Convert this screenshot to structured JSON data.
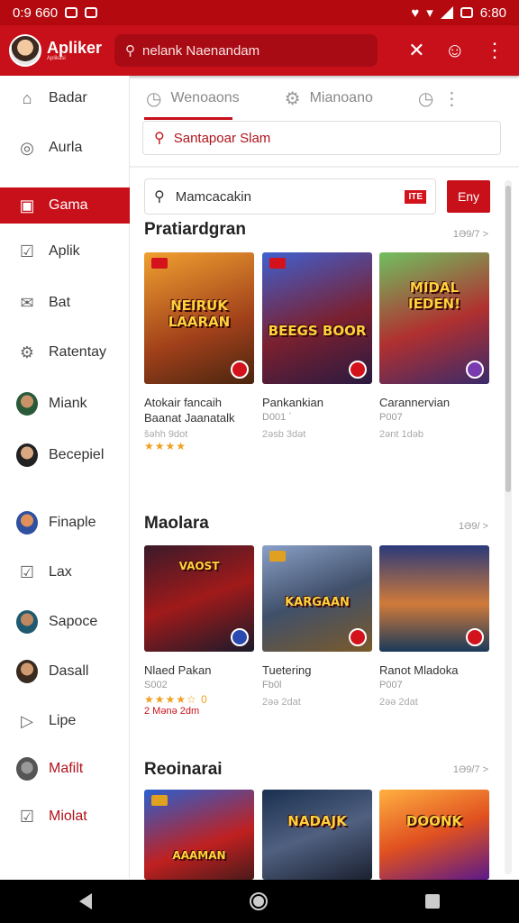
{
  "status_bar": {
    "time": "0:9 660",
    "right_text": "6:80"
  },
  "app_bar": {
    "title": "Apliker",
    "subtitle": "Aplikasi",
    "search_text": "nelank Naenandam"
  },
  "sidebar": {
    "items": [
      {
        "label": "Badar",
        "icon": "home-icon"
      },
      {
        "label": "Aurla",
        "icon": "circle-icon"
      },
      {
        "label": "Gama",
        "icon": "gamepad-icon",
        "active": true
      },
      {
        "label": "Aplik",
        "icon": "bag-icon"
      },
      {
        "label": "Bat",
        "icon": "mail-icon"
      },
      {
        "label": "Ratentay",
        "icon": "settings-icon"
      },
      {
        "label": "Miank",
        "icon": "avatar-icon"
      },
      {
        "label": "Becepiel",
        "icon": "avatar-icon"
      },
      {
        "label": "Finaple",
        "icon": "avatar-icon"
      },
      {
        "label": "Lax",
        "icon": "box-icon"
      },
      {
        "label": "Sapoce",
        "icon": "avatar-icon"
      },
      {
        "label": "Dasall",
        "icon": "avatar-icon"
      },
      {
        "label": "Lipe",
        "icon": "play-icon"
      },
      {
        "label": "Mafilt",
        "icon": "avatar-icon"
      },
      {
        "label": "Miolat",
        "icon": "box-icon"
      }
    ]
  },
  "tabs": [
    {
      "label": "Wenoaons",
      "icon": "clock-icon"
    },
    {
      "label": "Mianoano",
      "icon": "settings-icon"
    }
  ],
  "secondary_search": "Santapoar Slam",
  "main_search": {
    "value": "Mamcacakin",
    "badge": "ITE",
    "button": "Eny"
  },
  "sections": [
    {
      "title": "Pratiardgran",
      "more": "1Ə9/7 >",
      "cards": [
        {
          "logo": "NEIRUK LAARAN",
          "name": "Atokair fancaih",
          "sub": "Baanat Jaanatalk",
          "meta": "šəhh 9dot",
          "stars": "★★★★",
          "colors": [
            "#d9791e",
            "#4a2510"
          ]
        },
        {
          "logo": "BEEGS BOOR",
          "name": "Pankankian",
          "sub": "D001 ´",
          "meta": "2əsb 3dət",
          "colors": [
            "#2f4fb8",
            "#9a1f22"
          ]
        },
        {
          "logo": "MIDAL IEDEN!",
          "name": "Carannervian",
          "sub": "P007",
          "meta": "2ənt 1dəb",
          "colors": [
            "#3b8a4c",
            "#b4242a"
          ]
        }
      ]
    },
    {
      "title": "Maolara",
      "more": "1Ə9/ >",
      "cards": [
        {
          "logo": "VAOST",
          "name": "Nlaed Pakan",
          "sub": "S002",
          "meta": "★★★★☆ 0",
          "stars_label": "2 Mənə 2dm",
          "colors": [
            "#8a1414",
            "#2a2030"
          ]
        },
        {
          "logo": "KARGAAN",
          "name": "Tuetering",
          "sub": "Fb0l",
          "meta": "2əə 2dat",
          "colors": [
            "#4a6a9a",
            "#6a5020"
          ]
        },
        {
          "logo": "",
          "name": "Ranot Mladoka",
          "sub": "P007",
          "meta": "2əə 2dat",
          "colors": [
            "#1a3a6a",
            "#b06a2a"
          ]
        }
      ]
    },
    {
      "title": "Reoinarai",
      "more": "1Ə9/7 >",
      "cards": [
        {
          "logo": "AAAMAN",
          "name": "",
          "sub": "",
          "meta": "",
          "colors": [
            "#1a4ab0",
            "#c02020"
          ]
        },
        {
          "logo": "NADAJK",
          "name": "",
          "sub": "",
          "meta": "",
          "colors": [
            "#1a3050",
            "#506080"
          ]
        },
        {
          "logo": "DOONK",
          "name": "",
          "sub": "",
          "meta": "",
          "colors": [
            "#e07020",
            "#5a1a8a"
          ]
        }
      ]
    }
  ]
}
